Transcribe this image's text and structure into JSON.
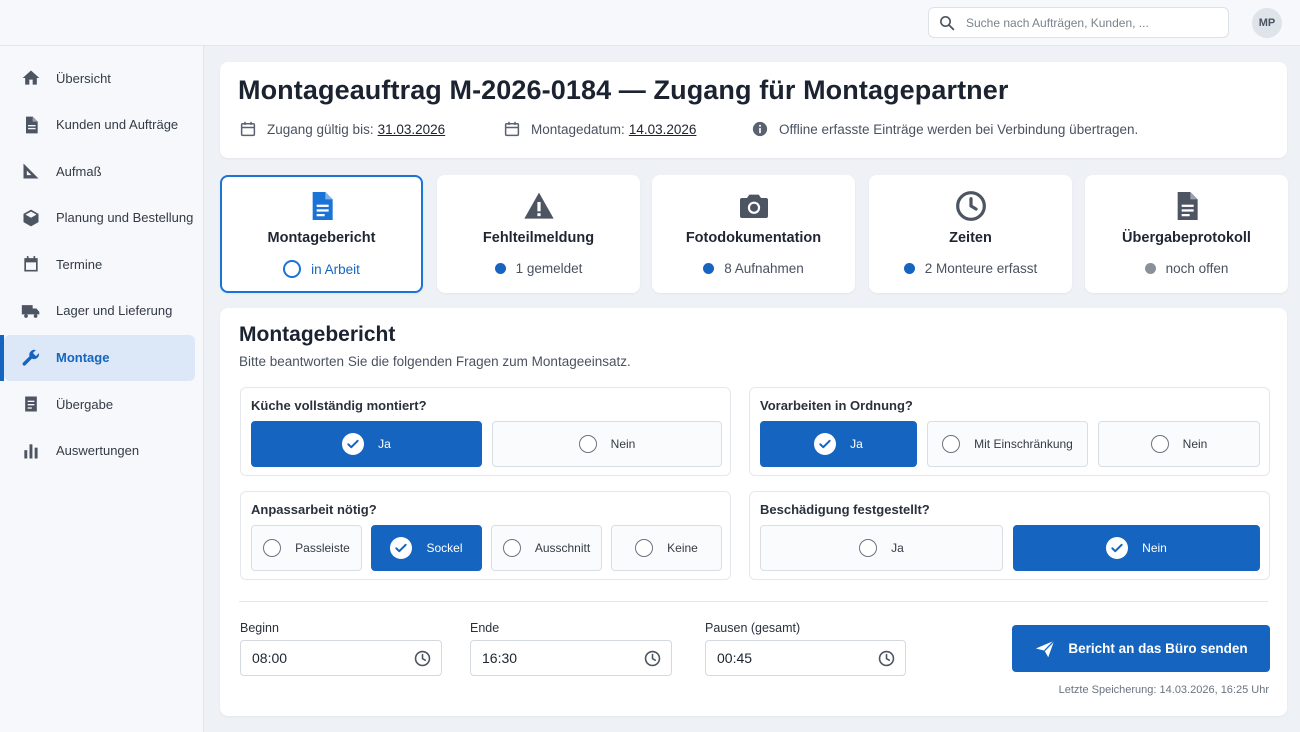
{
  "search": {
    "placeholder": "Suche nach Aufträgen, Kunden, ..."
  },
  "user": {
    "initials": "MP"
  },
  "sidebar": {
    "items": [
      {
        "label": "Übersicht",
        "icon": "home-icon"
      },
      {
        "label": "Kunden und Aufträge",
        "icon": "document-icon"
      },
      {
        "label": "Aufmaß",
        "icon": "ruler-triangle-icon"
      },
      {
        "label": "Planung und Bestellung",
        "icon": "package-icon"
      },
      {
        "label": "Termine",
        "icon": "calendar-icon"
      },
      {
        "label": "Lager und Lieferung",
        "icon": "truck-icon"
      },
      {
        "label": "Montage",
        "icon": "wrench-icon",
        "active": true
      },
      {
        "label": "Übergabe",
        "icon": "clipboard-icon"
      },
      {
        "label": "Auswertungen",
        "icon": "bar-chart-icon"
      }
    ]
  },
  "header": {
    "title": "Montageauftrag M-2026-0184 — Zugang für Montagepartner",
    "access_label": "Zugang gültig bis:",
    "access_value": "31.03.2026",
    "date_label": "Montagedatum:",
    "date_value": "14.03.2026",
    "offline_note": "Offline erfasste Einträge werden bei Verbindung übertragen."
  },
  "tiles": [
    {
      "label": "Montagebericht",
      "status": "in Arbeit",
      "icon": "document-icon",
      "active": true
    },
    {
      "label": "Fehlteilmeldung",
      "status": "1 gemeldet",
      "icon": "warning-icon"
    },
    {
      "label": "Fotodokumentation",
      "status": "8 Aufnahmen",
      "icon": "camera-icon"
    },
    {
      "label": "Zeiten",
      "status": "2 Monteure erfasst",
      "icon": "clock-icon"
    },
    {
      "label": "Übergabeprotokoll",
      "status": "noch offen",
      "icon": "document-icon"
    }
  ],
  "form": {
    "title": "Montagebericht",
    "subtitle": "Bitte beantworten Sie die folgenden Fragen zum Montageeinsatz.",
    "questions": {
      "q1": {
        "label": "Küche vollständig montiert?",
        "options": [
          "Ja",
          "Nein"
        ],
        "selected": "Ja"
      },
      "q2": {
        "label": "Vorarbeiten in Ordnung?",
        "options": [
          "Ja",
          "Mit Einschränkung",
          "Nein"
        ],
        "selected": "Ja"
      },
      "q3": {
        "label": "Anpassarbeit nötig?",
        "options": [
          "Passleiste",
          "Sockel",
          "Ausschnitt",
          "Keine"
        ],
        "selected": "Sockel"
      },
      "q4": {
        "label": "Beschädigung festgestellt?",
        "options": [
          "Ja",
          "Nein"
        ],
        "selected": "Nein"
      }
    },
    "times": {
      "start_label": "Beginn",
      "start_value": "08:00",
      "end_label": "Ende",
      "end_value": "16:30",
      "pause_label": "Pausen (gesamt)",
      "pause_value": "00:45"
    },
    "send_label": "Bericht an das Büro senden",
    "last_saved": "Letzte Speicherung: 14.03.2026, 16:25 Uhr"
  },
  "colors": {
    "accent": "#1565c0",
    "accent_light": "#dce8f7",
    "background": "#eef1f5",
    "status_grey": "#8a9099"
  }
}
